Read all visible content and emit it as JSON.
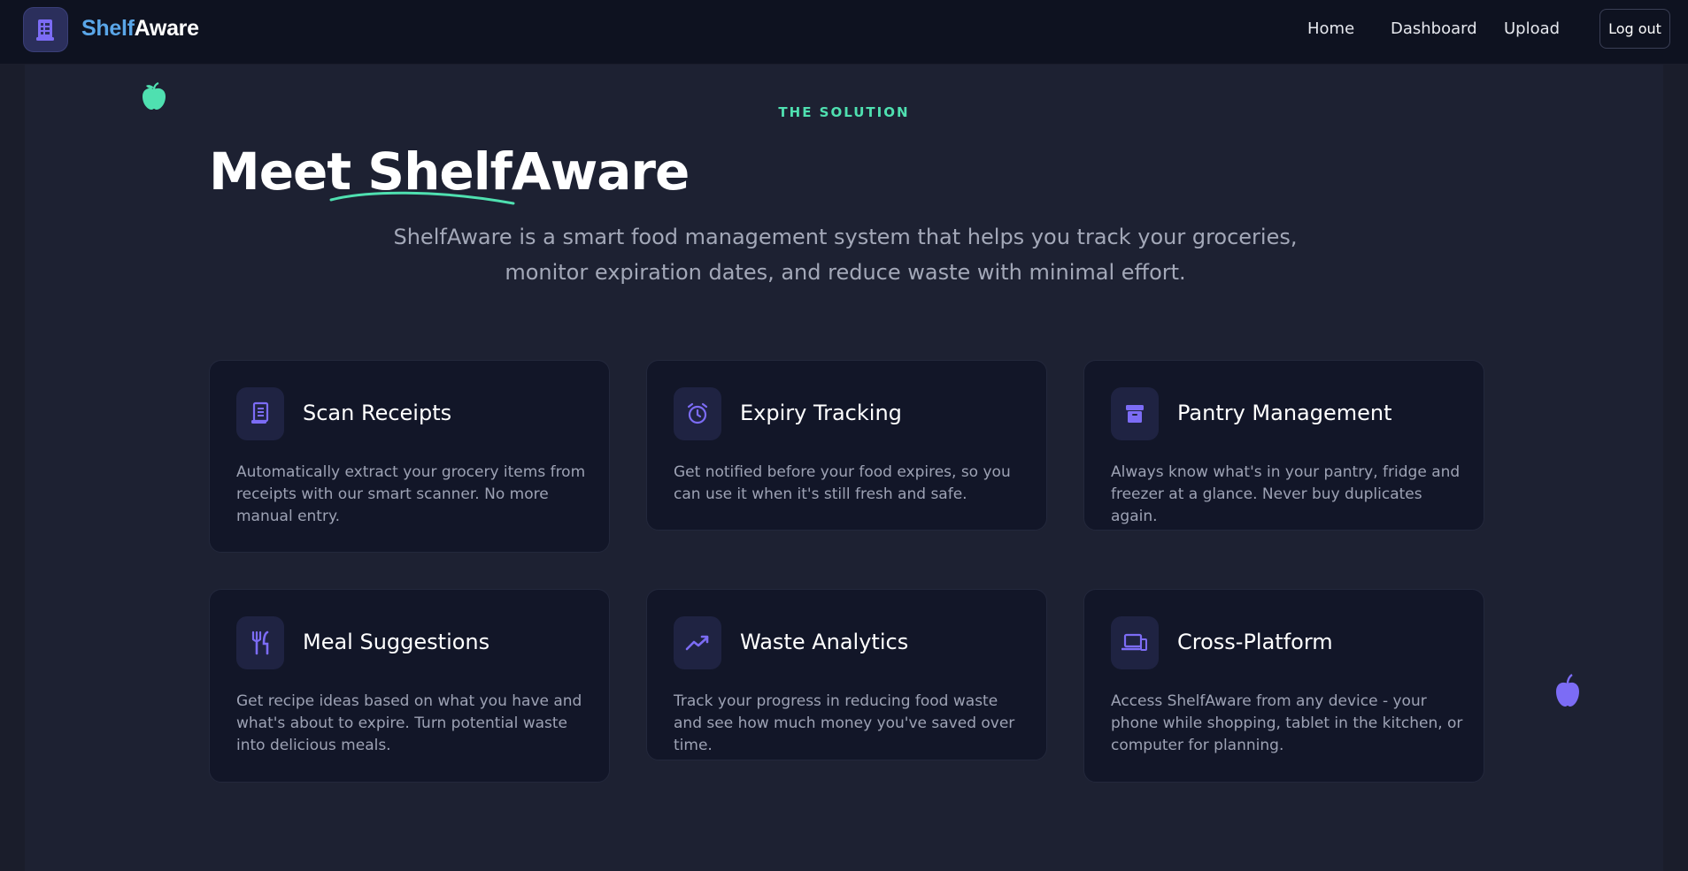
{
  "navbar": {
    "brand_part1": "Shelf",
    "brand_part2": "Aware",
    "links": [
      "Home",
      "Dashboard",
      "Upload"
    ],
    "logout_label": "Log out"
  },
  "hero": {
    "eyebrow": "THE SOLUTION",
    "headline": "Meet ShelfAware",
    "lead": "ShelfAware is a smart food management system that helps you track your groceries, monitor expiration dates, and reduce waste with minimal effort."
  },
  "features": [
    {
      "title": "Scan Receipts",
      "icon": "receipt-icon",
      "desc": "Automatically extract your grocery items from receipts with our smart scanner. No more manual entry."
    },
    {
      "title": "Expiry Tracking",
      "icon": "alarm-clock-icon",
      "desc": "Get notified before your food expires, so you can use it when it's still fresh and safe."
    },
    {
      "title": "Pantry Management",
      "icon": "archive-box-icon",
      "desc": "Always know what's in your pantry, fridge and freezer at a glance. Never buy duplicates again."
    },
    {
      "title": "Meal Suggestions",
      "icon": "fork-knife-icon",
      "desc": "Get recipe ideas based on what you have and what's about to expire. Turn potential waste into delicious meals."
    },
    {
      "title": "Waste Analytics",
      "icon": "trending-up-icon",
      "desc": "Track your progress in reducing food waste and see how much money you've saved over time."
    },
    {
      "title": "Cross-Platform",
      "icon": "devices-icon",
      "desc": "Access ShelfAware from any device - your phone while shopping, tablet in the kitchen, or computer for planning."
    }
  ],
  "colors": {
    "accent_teal": "#4fe0b0",
    "accent_purple": "#6e5ef0",
    "brand_blue": "#5aa6e8",
    "background": "#1d2132",
    "card_bg": "#121628"
  }
}
